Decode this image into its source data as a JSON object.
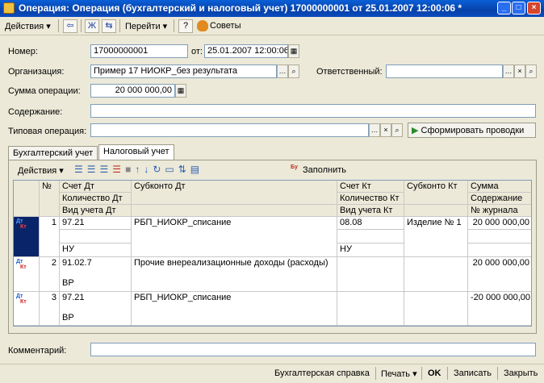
{
  "window": {
    "title": "Операция: Операция (бухгалтерский и налоговый учет) 17000000001 от 25.01.2007 12:00:06 *",
    "controls": [
      "_",
      "□",
      "×"
    ]
  },
  "toolbar": {
    "actions": "Действия ▾",
    "goto": "Перейти ▾",
    "help": "?",
    "tips": "Советы"
  },
  "form": {
    "number_label": "Номер:",
    "number": "17000000001",
    "date_label": "от:",
    "date": "25.01.2007 12:00:06",
    "org_label": "Организация:",
    "org": "Пример 17 НИОКР_без результата",
    "responsible_label": "Ответственный:",
    "responsible": "",
    "sum_label": "Сумма операции:",
    "sum": "20 000 000,00",
    "content_label": "Содержание:",
    "content": "",
    "typical_label": "Типовая операция:",
    "typical": "",
    "form_button": "Сформировать проводки",
    "comment_label": "Комментарий:",
    "comment": ""
  },
  "tabs": [
    {
      "label": "Бухгалтерский учет"
    },
    {
      "label": "Налоговый учет"
    }
  ],
  "table_toolbar": {
    "actions": "Действия ▾",
    "fill": "Заполнить"
  },
  "table": {
    "headers": {
      "n": "№",
      "dt": "Счет Дт",
      "qty_dt": "Количество Дт",
      "kind_dt": "Вид учета Дт",
      "sub_dt": "Субконто Дт",
      "kt": "Счет Кт",
      "qty_kt": "Количество Кт",
      "kind_kt": "Вид учета Кт",
      "sub_kt": "Субконто Кт",
      "sum": "Сумма",
      "content": "Содержание",
      "journal": "№ журнала"
    },
    "rows": [
      {
        "n": "1",
        "dt": "97.21",
        "kind_dt": "НУ",
        "sub_dt": "РБП_НИОКР_списание",
        "kt": "08.08",
        "kind_kt": "НУ",
        "sub_kt": "Изделие № 1",
        "sum": "20 000 000,00"
      },
      {
        "n": "2",
        "dt": "91.02.7",
        "kind_dt": "ВР",
        "sub_dt": "Прочие внереализационные доходы (расходы)",
        "kt": "",
        "kind_kt": "",
        "sub_kt": "",
        "sum": "20 000 000,00"
      },
      {
        "n": "3",
        "dt": "97.21",
        "kind_dt": "ВР",
        "sub_dt": "РБП_НИОКР_списание",
        "kt": "",
        "kind_kt": "",
        "sub_kt": "",
        "sum": "-20 000 000,00"
      }
    ],
    "row_mark": {
      "dt": "Дт",
      "kt": "Кт"
    }
  },
  "statusbar": {
    "report": "Бухгалтерская справка",
    "print": "Печать ▾",
    "ok": "OK",
    "save": "Записать",
    "close": "Закрыть"
  }
}
